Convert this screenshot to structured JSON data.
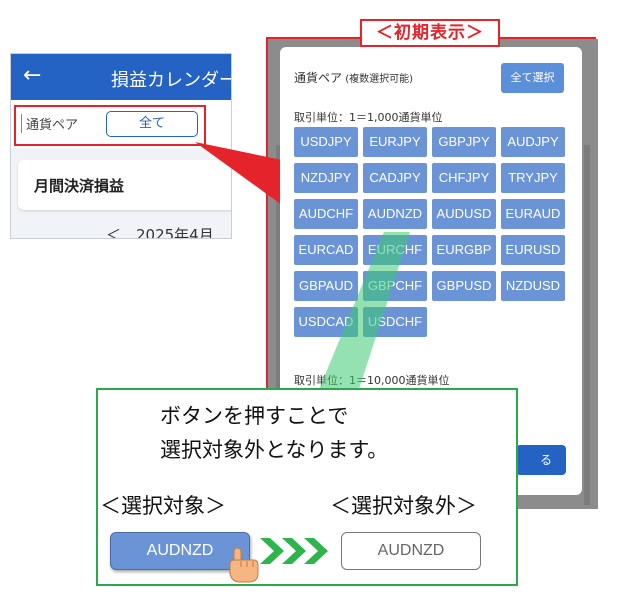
{
  "phone": {
    "back_glyph": "←",
    "title": "損益カレンダー",
    "pair_label": "通貨ペア",
    "all_button": "全て",
    "card_label": "月間決済損益",
    "month_text": "＜　2025年4月"
  },
  "panel": {
    "tag": "＜初期表示＞",
    "title_main": "通貨ペア",
    "title_sub": " (複数選択可能)",
    "select_all": "全て選択",
    "unit_1000": "取引単位：1＝1,000通貨単位",
    "unit_10000": "取引単位：1＝10,000通貨単位",
    "close_fragment": "る",
    "pairs": [
      "USDJPY",
      "EURJPY",
      "GBPJPY",
      "AUDJPY",
      "NZDJPY",
      "CADJPY",
      "CHFJPY",
      "TRYJPY",
      "AUDCHF",
      "AUDNZD",
      "AUDUSD",
      "EURAUD",
      "EURCAD",
      "EURCHF",
      "EURGBP",
      "EURUSD",
      "GBPAUD",
      "GBPCHF",
      "GBPUSD",
      "NZDUSD",
      "USDCAD",
      "USDCHF"
    ]
  },
  "callout": {
    "line1": "ボタンを押すことで",
    "line2": "選択対象外となります。",
    "selected_label": "＜選択対象＞",
    "unselected_label": "＜選択対象外＞",
    "selected_button": "AUDNZD",
    "unselected_button": "AUDNZD"
  },
  "colors": {
    "brand_blue": "#2463c4",
    "pair_blue": "#6b94d6",
    "highlight_red": "#e4232b",
    "callout_green": "#2aa84a"
  }
}
